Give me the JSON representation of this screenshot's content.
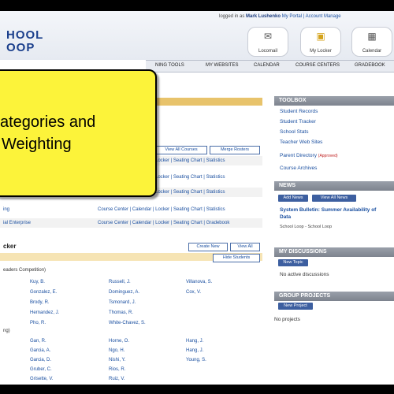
{
  "header": {
    "logo_line1": "HOOL",
    "logo_line2": "OOP",
    "logged_in_label": "logged in as",
    "user_name": "Mark Lushenko",
    "links": "My Portal | Account Manage",
    "buttons": [
      {
        "label": "Locomail",
        "icon": "mail-icon"
      },
      {
        "label": "My Locker",
        "icon": "locker-icon"
      },
      {
        "label": "Calendar",
        "icon": "calendar-icon"
      }
    ]
  },
  "nav": {
    "items": [
      "NING TOOLS",
      "MY WEBSITES",
      "CALENDAR",
      "COURSE CENTERS",
      "GRADEBOOK"
    ]
  },
  "main": {
    "view_all_courses": "View All Courses",
    "merge_rosters": "Merge Rosters",
    "course_rows": [
      "Locker | Seating Chart | Statistics",
      "Locker | Seating Chart | Statistics",
      "Locker | Seating Chart | Statistics",
      "Course Center | Calendar | Locker | Seating Chart | Statistics",
      "Course Center | Calendar | Locker | Seating Chart | Gradebook"
    ],
    "course_fragment": "ial Enterprise",
    "ing_fragment": "ing",
    "tracker_title": "cker",
    "create_new": "Create New",
    "view_all": "View All",
    "hide_students": "Hide Students",
    "group1_label": "eaders Competition)",
    "group2_label": "ng)",
    "students_col1": [
      "Kuy, B.",
      "Gonzalez, E.",
      "Brody, R.",
      "Hernandez, J.",
      "Pho, R."
    ],
    "students_col2": [
      "Russell, J.",
      "Dominguez, A.",
      "Tsmonard, J.",
      "Thomas, R.",
      "White-Chavez, S."
    ],
    "students_col3": [
      "Villanova, S.",
      "Cox, V."
    ],
    "students2_col1": [
      "Gan, R.",
      "Garcia, A.",
      "Garcia, D.",
      "Gruber, C.",
      "Grisette, V."
    ],
    "students2_col2": [
      "Horne, O.",
      "Ngo, H.",
      "Nishi, Y.",
      "Rios, R.",
      "Ruiz, V."
    ],
    "students2_col3": [
      "Hang, J.",
      "Hang, J.",
      "Young, S."
    ]
  },
  "overlay": {
    "line1": "ategories and",
    "line2": "Weighting"
  },
  "sidebar": {
    "toolbox_title": "TOOLBOX",
    "toolbox_links": [
      "Student Records",
      "Student Tracker",
      "School Stats",
      "Teacher Web Sites"
    ],
    "parent_directory": "Parent Directory",
    "approved": "(Approved)",
    "course_archives": "Course Archives",
    "news_title": "NEWS",
    "add_news": "Add News",
    "view_all_news": "View All News",
    "news_headline": "System Bulletin: Summer Availability of",
    "news_headline2": "Data",
    "news_source": "School Loop - School Loop",
    "discussions_title": "MY DISCUSSIONS",
    "new_topic": "New Topic",
    "no_discussions": "No active discussions",
    "projects_title": "GROUP PROJECTS",
    "new_project": "New Project",
    "no_projects": "No projects"
  },
  "colors": {
    "overlay": "#fcf33a",
    "accent_bar": "#e8c36b",
    "link": "#1a4fa0",
    "panel_header": "#8a909b"
  }
}
